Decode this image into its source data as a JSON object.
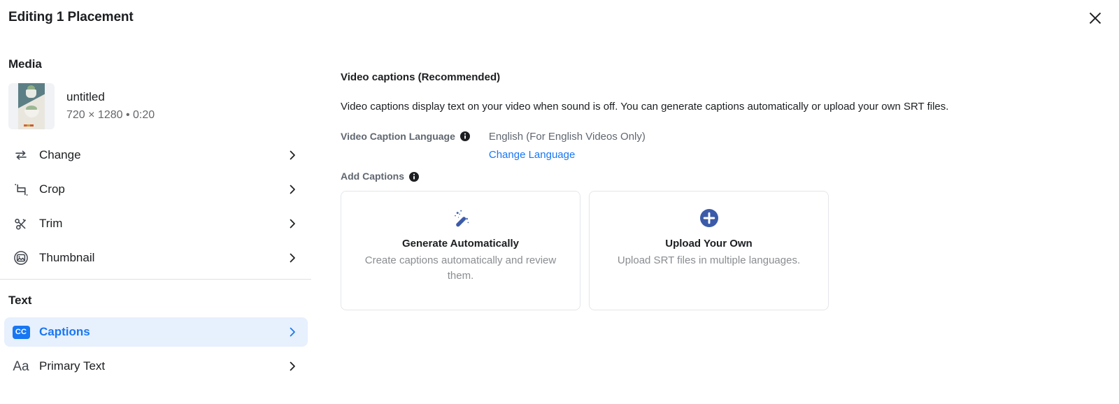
{
  "header": {
    "title": "Editing 1 Placement",
    "close_label": "Close"
  },
  "sidebar": {
    "media_section": {
      "title": "Media",
      "asset": {
        "name": "untitled",
        "dimensions": "720 × 1280 • 0:20"
      },
      "items": [
        {
          "label": "Change",
          "icon": "swap-arrows-icon"
        },
        {
          "label": "Crop",
          "icon": "crop-icon"
        },
        {
          "label": "Trim",
          "icon": "scissors-icon"
        },
        {
          "label": "Thumbnail",
          "icon": "photo-circle-icon"
        }
      ]
    },
    "text_section": {
      "title": "Text",
      "items": [
        {
          "label": "Captions",
          "icon": "cc-icon",
          "icon_text": "CC",
          "active": true
        },
        {
          "label": "Primary Text",
          "icon": "aa-icon",
          "icon_text": "Aa",
          "active": false
        }
      ]
    }
  },
  "main": {
    "heading": "Video captions (Recommended)",
    "description": "Video captions display text on your video when sound is off. You can generate captions automatically or upload your own SRT files.",
    "language": {
      "label": "Video Caption Language",
      "value": "English (For English Videos Only)",
      "change_link": "Change Language"
    },
    "add_captions_label": "Add Captions",
    "cards": [
      {
        "title": "Generate Automatically",
        "subtitle": "Create captions automatically and review them.",
        "icon": "magic-wand-icon"
      },
      {
        "title": "Upload Your Own",
        "subtitle": "Upload SRT files in multiple languages.",
        "icon": "plus-circle-icon"
      }
    ]
  },
  "colors": {
    "accent": "#1877f2",
    "active_row_bg": "#e7f0fd",
    "text_primary": "#1c1e21",
    "text_secondary": "#606770",
    "text_muted": "#8a8d91",
    "border": "#e4e6eb"
  }
}
